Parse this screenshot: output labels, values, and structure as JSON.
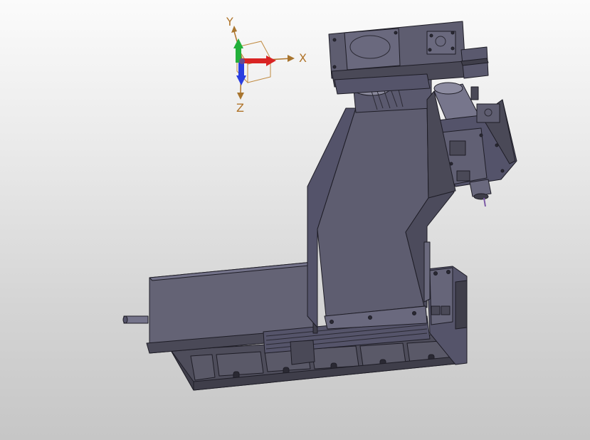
{
  "viewport": {
    "triad": {
      "x_label": "X",
      "y_label": "Y",
      "z_label": "Z",
      "colors": {
        "x_arrow": "#d92424",
        "y_arrow": "#22b03a",
        "z_arrow": "#2a3de0",
        "axis_text": "#b0742a",
        "cube": "#c08a40"
      }
    },
    "model": {
      "body_color": "#5e5d6c",
      "edge_color": "#1e1d26",
      "highlight_color": "#75748a",
      "shadow_color": "#4a4957"
    }
  }
}
